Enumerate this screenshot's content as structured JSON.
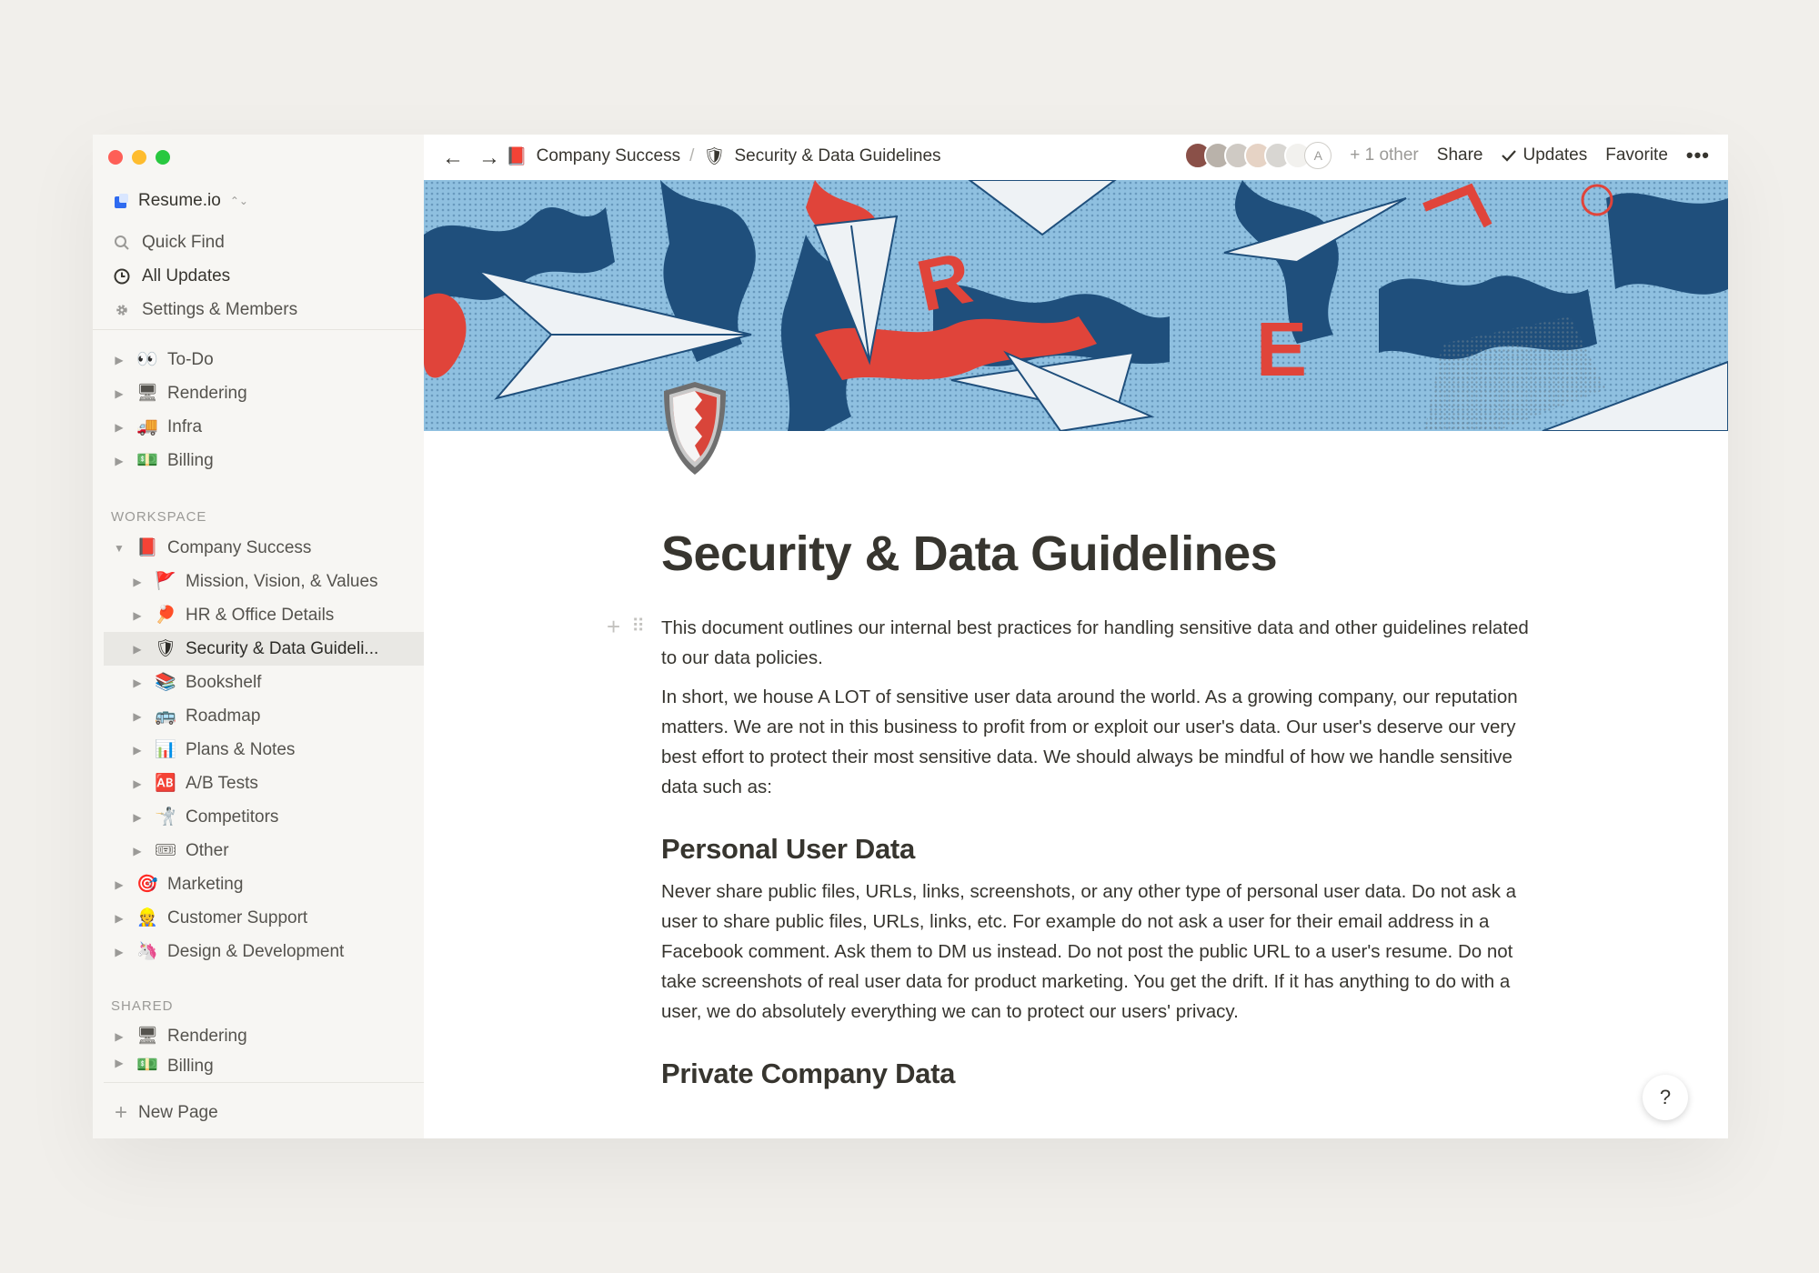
{
  "window": {
    "traffic_lights": [
      "close",
      "minimize",
      "zoom"
    ]
  },
  "sidebar": {
    "workspace_name": "Resume.io",
    "quick_links": [
      {
        "label": "Quick Find",
        "icon": "search-icon"
      },
      {
        "label": "All Updates",
        "icon": "clock-icon"
      },
      {
        "label": "Settings & Members",
        "icon": "gear-icon"
      }
    ],
    "private_pages": [
      {
        "label": "To-Do",
        "emoji": "👀"
      },
      {
        "label": "Rendering",
        "emoji": "🖥"
      },
      {
        "label": "Infra",
        "emoji": "🚚"
      },
      {
        "label": "Billing",
        "emoji": "💵"
      }
    ],
    "workspace_label": "WORKSPACE",
    "workspace_pages": [
      {
        "label": "Company Success",
        "emoji": "📕",
        "level": 0,
        "expanded": true
      },
      {
        "label": "Mission, Vision, & Values",
        "emoji": "🚩",
        "level": 1
      },
      {
        "label": "HR & Office Details",
        "emoji": "🏓",
        "level": 1
      },
      {
        "label": "Security & Data Guideli...",
        "emoji": "🛡",
        "level": 1,
        "selected": true
      },
      {
        "label": "Bookshelf",
        "emoji": "📚",
        "level": 1
      },
      {
        "label": "Roadmap",
        "emoji": "🚌",
        "level": 1
      },
      {
        "label": "Plans & Notes",
        "emoji": "📊",
        "level": 1
      },
      {
        "label": "A/B Tests",
        "emoji": "🆎",
        "level": 1
      },
      {
        "label": "Competitors",
        "emoji": "🤺",
        "level": 1
      },
      {
        "label": "Other",
        "emoji": "🎟",
        "level": 1
      },
      {
        "label": "Marketing",
        "emoji": "🎯",
        "level": 0
      },
      {
        "label": "Customer Support",
        "emoji": "👷",
        "level": 0
      },
      {
        "label": "Design & Development",
        "emoji": "🦄",
        "level": 0
      }
    ],
    "shared_label": "SHARED",
    "shared_pages": [
      {
        "label": "Rendering",
        "emoji": "🖥"
      },
      {
        "label": "Billing",
        "emoji": "💵"
      }
    ],
    "new_page_label": "New Page"
  },
  "topbar": {
    "breadcrumbs": [
      {
        "label": "Company Success",
        "emoji": "📕"
      },
      {
        "label": "Security & Data Guidelines",
        "emoji": "🛡"
      }
    ],
    "avatar_letter": "A",
    "other_label": "+ 1 other",
    "share_label": "Share",
    "updates_label": "Updates",
    "favorite_label": "Favorite",
    "more_label": "•••"
  },
  "page": {
    "title": "Security & Data Guidelines",
    "intro": "This document outlines our internal best practices for handling sensitive data and other guidelines related to our data policies.",
    "summary": "In short, we house A LOT of sensitive user data around the world. As a growing company, our reputation matters. We are not in this business to profit from or exploit our user's data. Our user's deserve our very best effort to protect their most sensitive data. We should always be mindful of how we handle sensitive data such as:",
    "section1_heading": "Personal User Data",
    "section1_body": "Never share public files, URLs, links, screenshots, or any other type of personal user data. Do not ask a user to share public files, URLs, links, etc. For example do not ask a user for their email address in a Facebook comment. Ask them to DM us instead. Do not post the public URL to a user's resume. Do not take screenshots of real user data for product marketing. You get the drift. If it has anything to do with a user, we do absolutely everything we can to protect our users' privacy.",
    "section2_heading": "Private Company Data",
    "cover_letters": [
      "R",
      "E"
    ]
  },
  "help_label": "?",
  "colors": {
    "sidebar_bg": "#f7f6f3",
    "selected_bg": "#e9e8e4",
    "text": "#37352f",
    "muted": "#9b9a97",
    "cover_blue": "#8fc0e0",
    "cover_navy": "#1f4f7c",
    "cover_red": "#e0443a"
  }
}
